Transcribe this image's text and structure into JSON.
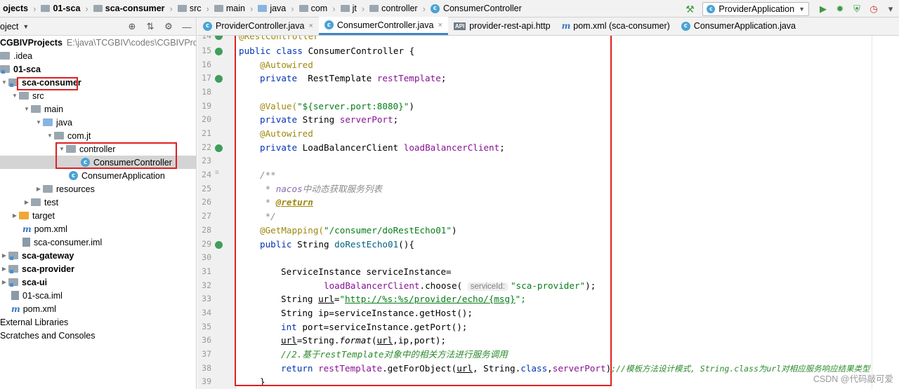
{
  "breadcrumb": [
    "ojects",
    "01-sca",
    "sca-consumer",
    "src",
    "main",
    "java",
    "com",
    "jt",
    "controller",
    "ConsumerController"
  ],
  "run_config": "ProviderApplication",
  "project_panel": {
    "title": "oject"
  },
  "tree": [
    {
      "label": "CGBIVProjects",
      "path": "E:\\java\\TCGBIV\\codes\\CGBIVProjects",
      "bold": true
    },
    {
      "label": ".idea"
    },
    {
      "label": "01-sca",
      "bold": true
    },
    {
      "label": "sca-consumer",
      "bold": true
    },
    {
      "label": "src"
    },
    {
      "label": "main"
    },
    {
      "label": "java"
    },
    {
      "label": "com.jt"
    },
    {
      "label": "controller"
    },
    {
      "label": "ConsumerController"
    },
    {
      "label": "ConsumerApplication"
    },
    {
      "label": "resources"
    },
    {
      "label": "test"
    },
    {
      "label": "target"
    },
    {
      "label": "pom.xml"
    },
    {
      "label": "sca-consumer.iml"
    },
    {
      "label": "sca-gateway",
      "bold": true
    },
    {
      "label": "sca-provider",
      "bold": true
    },
    {
      "label": "sca-ui",
      "bold": true
    },
    {
      "label": "01-sca.iml"
    },
    {
      "label": "pom.xml"
    },
    {
      "label": "External Libraries"
    },
    {
      "label": "Scratches and Consoles"
    }
  ],
  "tabs": [
    {
      "label": "ProviderController.java",
      "active": false
    },
    {
      "label": "ConsumerController.java",
      "active": true
    },
    {
      "label": "provider-rest-api.http",
      "active": false
    },
    {
      "label": "pom.xml (sca-consumer)",
      "active": false
    },
    {
      "label": "ConsumerApplication.java",
      "active": false
    }
  ],
  "line_numbers": [
    "14",
    "15",
    "16",
    "17",
    "18",
    "19",
    "20",
    "21",
    "22",
    "23",
    "24",
    "25",
    "26",
    "27",
    "28",
    "29",
    "30",
    "31",
    "32",
    "33",
    "34",
    "35",
    "36",
    "37",
    "38",
    "39"
  ],
  "code": {
    "l14": "@RestController",
    "l15a": "public class",
    "l15b": " ConsumerController {",
    "l16": "@Autowired",
    "l17a": "private",
    "l17b": "  RestTemplate ",
    "l17c": "restTemplate",
    "l17d": ";",
    "l19a": "@Value(",
    "l19b": "\"${server.port:8080}\"",
    "l19c": ")",
    "l20a": "private",
    "l20b": " String ",
    "l20c": "serverPort",
    "l20d": ";",
    "l21": "@Autowired",
    "l22a": "private",
    "l22b": " LoadBalancerClient ",
    "l22c": "loadBalancerClient",
    "l22d": ";",
    "l24": "/**",
    "l25a": " * ",
    "l25b": "nacos",
    "l25c": "中动态获取服务列表",
    "l26a": " * ",
    "l26b": "@return",
    "l27": " */",
    "l28a": "@GetMapping(",
    "l28b": "\"/consumer/doRestEcho01\"",
    "l28c": ")",
    "l29a": "public",
    "l29b": " String ",
    "l29c": "doRestEcho01",
    "l29d": "(){",
    "l31": "ServiceInstance serviceInstance=",
    "l32a": "loadBalancerClient",
    "l32b": ".choose( ",
    "l32hint": "serviceId:",
    "l32c": "\"sca-provider\"",
    "l32d": ");",
    "l33a": "String ",
    "l33b": "url",
    "l33c": "=",
    "l33d": "\"",
    "l33e": "http://%s:%s/provider/echo/{msg}",
    "l33f": "\";",
    "l34": "String ip=serviceInstance.getHost();",
    "l35a": "int",
    "l35b": " port=serviceInstance.getPort();",
    "l36a": "url",
    "l36b": "=String.",
    "l36c": "format",
    "l36d": "(",
    "l36e": "url",
    "l36f": ",ip,port);",
    "l37": "//2.基于restTemplate对象中的相关方法进行服务调用",
    "l38a": "return ",
    "l38b": "restTemplate",
    "l38c": ".getForObject(",
    "l38d": "url",
    "l38e": ", String.",
    "l38f": "class",
    "l38g": ",",
    "l38h": "serverPort",
    "l38i": ")",
    "l38j": ";//模板方法设计模式, String.class为url对相应服务响应结果类型",
    "l39": "}"
  },
  "watermark": "CSDN @代码敲可爱",
  "colors": {
    "highlight_box": "#e02020",
    "active_tab_underline": "#4083c9",
    "selection": "#d4d4d4"
  }
}
